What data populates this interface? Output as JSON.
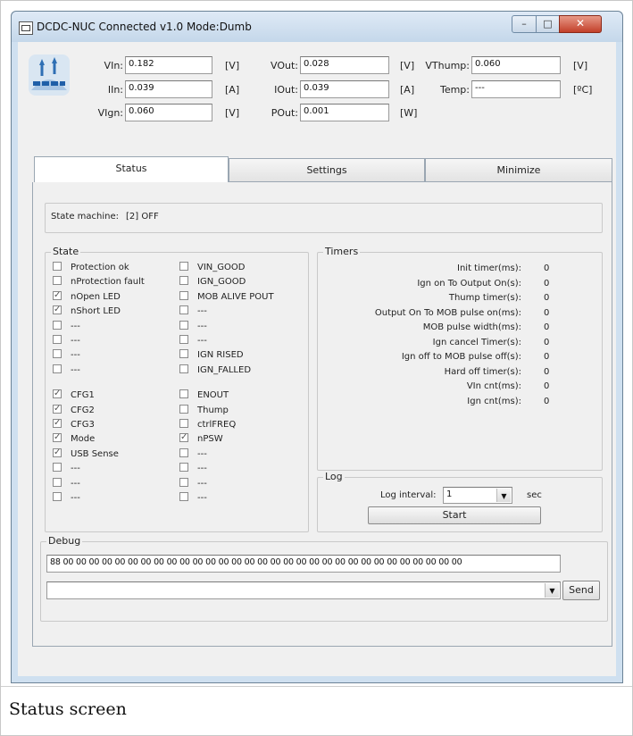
{
  "window": {
    "title": "DCDC-NUC Connected v1.0 Mode:Dumb"
  },
  "readings": {
    "vin": {
      "label": "VIn:",
      "value": "0.182",
      "unit": "[V]"
    },
    "iin": {
      "label": "IIn:",
      "value": "0.039",
      "unit": "[A]"
    },
    "vign": {
      "label": "VIgn:",
      "value": "0.060",
      "unit": "[V]"
    },
    "vout": {
      "label": "VOut:",
      "value": "0.028",
      "unit": "[V]"
    },
    "iout": {
      "label": "IOut:",
      "value": "0.039",
      "unit": "[A]"
    },
    "pout": {
      "label": "POut:",
      "value": "0.001",
      "unit": "[W]"
    },
    "vthump": {
      "label": "VThump:",
      "value": "0.060",
      "unit": "[V]"
    },
    "temp": {
      "label": "Temp:",
      "value": "---",
      "unit": "[ºC]"
    }
  },
  "tabs": [
    "Status",
    "Settings",
    "Minimize"
  ],
  "state_machine": {
    "label": "State machine:",
    "value": "[2] OFF"
  },
  "state": {
    "title": "State",
    "col1": [
      {
        "label": "Protection ok",
        "checked": false
      },
      {
        "label": "nProtection fault",
        "checked": false
      },
      {
        "label": "nOpen LED",
        "checked": true
      },
      {
        "label": "nShort LED",
        "checked": true
      },
      {
        "label": "---",
        "checked": false
      },
      {
        "label": "---",
        "checked": false
      },
      {
        "label": "---",
        "checked": false
      },
      {
        "label": "---",
        "checked": false
      },
      {
        "label": "CFG1",
        "checked": true
      },
      {
        "label": "CFG2",
        "checked": true
      },
      {
        "label": "CFG3",
        "checked": true
      },
      {
        "label": "Mode",
        "checked": true
      },
      {
        "label": "USB Sense",
        "checked": true
      },
      {
        "label": "---",
        "checked": false
      },
      {
        "label": "---",
        "checked": false
      },
      {
        "label": "---",
        "checked": false
      }
    ],
    "col2": [
      {
        "label": "VIN_GOOD",
        "checked": false
      },
      {
        "label": "IGN_GOOD",
        "checked": false
      },
      {
        "label": "MOB ALIVE POUT",
        "checked": false
      },
      {
        "label": "---",
        "checked": false
      },
      {
        "label": "---",
        "checked": false
      },
      {
        "label": "---",
        "checked": false
      },
      {
        "label": "IGN RISED",
        "checked": false
      },
      {
        "label": "IGN_FALLED",
        "checked": false
      },
      {
        "label": "ENOUT",
        "checked": false
      },
      {
        "label": "Thump",
        "checked": false
      },
      {
        "label": "ctrlFREQ",
        "checked": false
      },
      {
        "label": "nPSW",
        "checked": true
      },
      {
        "label": "---",
        "checked": false
      },
      {
        "label": "---",
        "checked": false
      },
      {
        "label": "---",
        "checked": false
      },
      {
        "label": "---",
        "checked": false
      }
    ]
  },
  "timers": {
    "title": "Timers",
    "rows": [
      {
        "label": "Init timer(ms):",
        "value": "0"
      },
      {
        "label": "Ign on To Output On(s):",
        "value": "0"
      },
      {
        "label": "Thump timer(s):",
        "value": "0"
      },
      {
        "label": "Output On To MOB pulse on(ms):",
        "value": "0"
      },
      {
        "label": "MOB pulse width(ms):",
        "value": "0"
      },
      {
        "label": "Ign cancel Timer(s):",
        "value": "0"
      },
      {
        "label": "Ign off to MOB pulse off(s):",
        "value": "0"
      },
      {
        "label": "Hard off timer(s):",
        "value": "0"
      },
      {
        "label": "VIn cnt(ms):",
        "value": "0"
      },
      {
        "label": "Ign cnt(ms):",
        "value": "0"
      }
    ]
  },
  "log": {
    "title": "Log",
    "interval_label": "Log interval:",
    "interval_value": "1",
    "unit": "sec",
    "start_label": "Start"
  },
  "debug": {
    "title": "Debug",
    "output": "88 00 00 00 00 00 00 00 00 00 00 00 00 00 00 00 00 00 00 00 00 00 00 00 00 00 00 00 00 00 00 00",
    "send_label": "Send"
  },
  "caption": "Status screen"
}
